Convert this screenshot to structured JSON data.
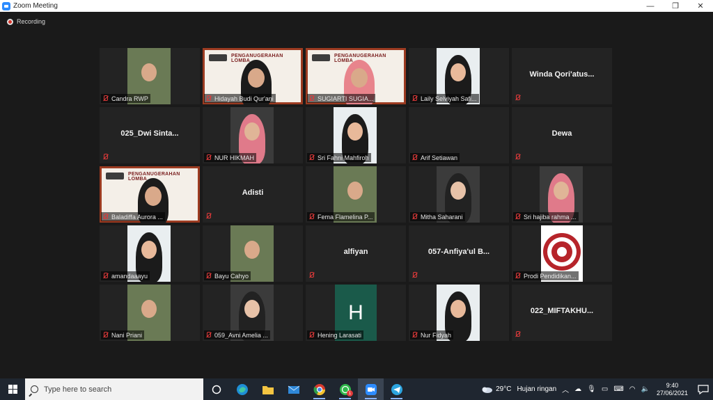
{
  "window": {
    "title": "Zoom Meeting",
    "minimize": "—",
    "restore": "❐",
    "close": "✕"
  },
  "recording_label": "Recording",
  "participants": [
    {
      "name": "Candra RWP",
      "video": "photo"
    },
    {
      "name": "Hidayah Budi Qur'ani",
      "video": "slide",
      "slide_title": "PENGANUGERAHAN LOMBA",
      "speaking": true
    },
    {
      "name": "SUGIARTI SUGIA...",
      "video": "slide",
      "slide_title": "PENGANUGERAHAN LOMBA",
      "pinned": true
    },
    {
      "name": "Laily Selviyah Safi...",
      "video": "photo"
    },
    {
      "name": "Winda  Qori'atus...",
      "video": "none"
    },
    {
      "name": "025_Dwi  Sinta...",
      "video": "none"
    },
    {
      "name": "NUR HIKMAH",
      "video": "photo"
    },
    {
      "name": "Sri Fahni Mahfiroh",
      "video": "photo"
    },
    {
      "name": "Arif Setiawan",
      "video": "off"
    },
    {
      "name": "Dewa",
      "video": "none"
    },
    {
      "name": "Baladiffa Aurora ...",
      "video": "slide",
      "slide_title": "PENGANUGERAHAN LOMBA"
    },
    {
      "name": "Adisti",
      "video": "none"
    },
    {
      "name": "Fema Flamelina P...",
      "video": "photo"
    },
    {
      "name": "Mitha Saharani",
      "video": "photo"
    },
    {
      "name": "Sri hajiba rahma ...",
      "video": "photo"
    },
    {
      "name": "amandaaayu",
      "video": "photo"
    },
    {
      "name": "Bayu Cahyo",
      "video": "photo"
    },
    {
      "name": "alfiyan",
      "video": "none"
    },
    {
      "name": "057-Anfiya'ul  B...",
      "video": "none"
    },
    {
      "name": "Prodi Pendidikan...",
      "video": "logo"
    },
    {
      "name": "Nani Priani",
      "video": "photo"
    },
    {
      "name": "059_Avni Amelia ...",
      "video": "photo"
    },
    {
      "name": "Hening Larasati",
      "video": "avatar",
      "avatar_letter": "H"
    },
    {
      "name": "Nur Fidyah",
      "video": "photo"
    },
    {
      "name": "022_MIFTAKHU...",
      "video": "none"
    }
  ],
  "taskbar": {
    "search_placeholder": "Type here to search",
    "apps": [
      "task-view",
      "edge",
      "file-explorer",
      "mail",
      "chrome",
      "whatsapp",
      "zoom",
      "telegram"
    ],
    "whatsapp_badge": "1",
    "weather_temp": "29°C",
    "weather_desc": "Hujan ringan",
    "time": "9:40",
    "date": "27/06/2021"
  },
  "colors": {
    "speaking_border": "#e8d64a",
    "pinned_border": "#c9592a",
    "muted_icon": "#e03a3a",
    "avatar_bg": "#1a5a4a"
  }
}
